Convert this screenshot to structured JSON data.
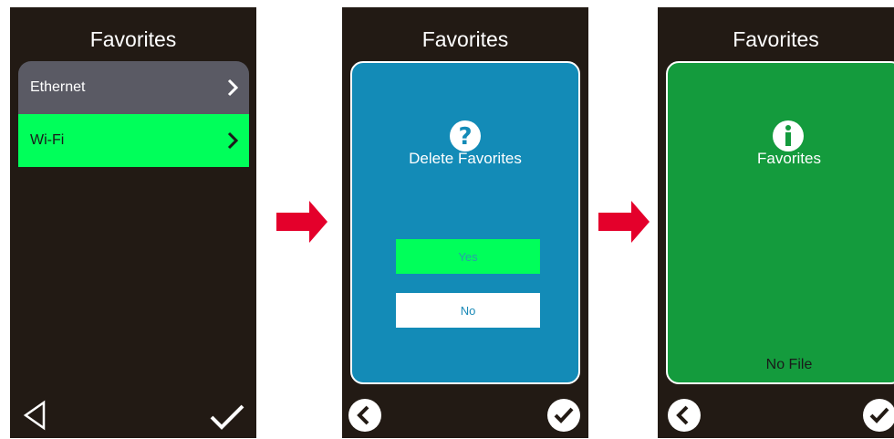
{
  "screen1": {
    "title": "Favorites",
    "items": [
      {
        "label": "Ethernet"
      },
      {
        "label": "Wi-Fi"
      }
    ]
  },
  "screen2": {
    "title": "Favorites",
    "message": "Delete Favorites",
    "yes_label": "Yes",
    "no_label": "No"
  },
  "screen3": {
    "title": "Favorites",
    "message": "Favorites",
    "status": "No File"
  },
  "colors": {
    "screen_bg": "#221a14",
    "selected": "#00ff5a",
    "dialog_blue": "#138bb7",
    "dialog_green": "#149b3d",
    "arrow": "#e4002b"
  }
}
